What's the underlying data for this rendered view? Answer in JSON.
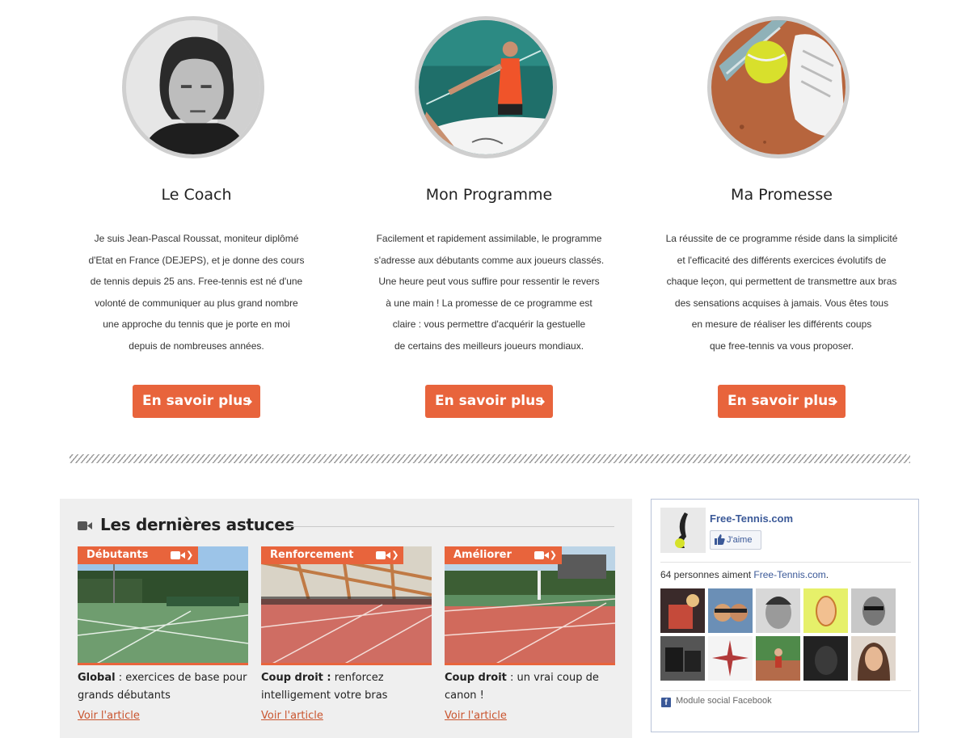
{
  "features": [
    {
      "title": "Le Coach",
      "image_icon": "coach-portrait",
      "lines": [
        "Je suis Jean-Pascal Roussat, moniteur diplômé",
        "d'Etat en France (DEJEPS), et je donne des cours",
        "de tennis depuis 25 ans. Free-tennis est né d'une",
        "volonté de communiquer au plus grand nombre",
        "une approche du tennis que je porte en moi",
        "depuis de nombreuses années."
      ],
      "button": "En savoir plus"
    },
    {
      "title": "Mon Programme",
      "image_icon": "programme-illustration",
      "lines": [
        "Facilement et rapidement assimilable, le programme",
        "s'adresse aux débutants comme aux joueurs classés.",
        "Une heure peut vous suffire pour ressentir le revers",
        "à une main ! La promesse de ce programme est",
        "claire : vous permettre d'acquérir la gestuelle",
        "de certains des meilleurs joueurs mondiaux."
      ],
      "button": "En savoir plus"
    },
    {
      "title": "Ma Promesse",
      "image_icon": "tennis-ball-shoe",
      "lines": [
        "La réussite de ce programme réside dans la simplicité",
        "et l'efficacité des différents exercices évolutifs de",
        "chaque leçon, qui permettent de transmettre aux bras",
        "des sensations acquises à jamais. Vous êtes tous",
        "en mesure de réaliser les différents coups",
        "que free-tennis va vous proposer."
      ],
      "button": "En savoir plus"
    }
  ],
  "tips": {
    "title": "Les dernières astuces",
    "cards": [
      {
        "tag": "Débutants",
        "bold": "Global",
        "text_line1": " : exercices de base pour",
        "text_line2": "grands débutants",
        "link": "Voir l'article"
      },
      {
        "tag": "Renforcement",
        "bold": "Coup droit :",
        "text_line1": " renforcez",
        "text_line2": "intelligement votre bras",
        "link": "Voir l'article"
      },
      {
        "tag": "Améliorer",
        "bold": "Coup droit",
        "text_line1": " : un vrai coup de",
        "text_line2": "canon !",
        "link": "Voir l'article"
      }
    ]
  },
  "facebook": {
    "page_name": "Free-Tennis.com",
    "like_label": "J'aime",
    "count_prefix": "64 personnes aiment ",
    "count_link": "Free-Tennis.com",
    "count_suffix": ".",
    "footer": "Module social Facebook"
  },
  "colors": {
    "accent": "#e8643c",
    "facebook_blue": "#3b5998",
    "panel_bg": "#efefef"
  }
}
